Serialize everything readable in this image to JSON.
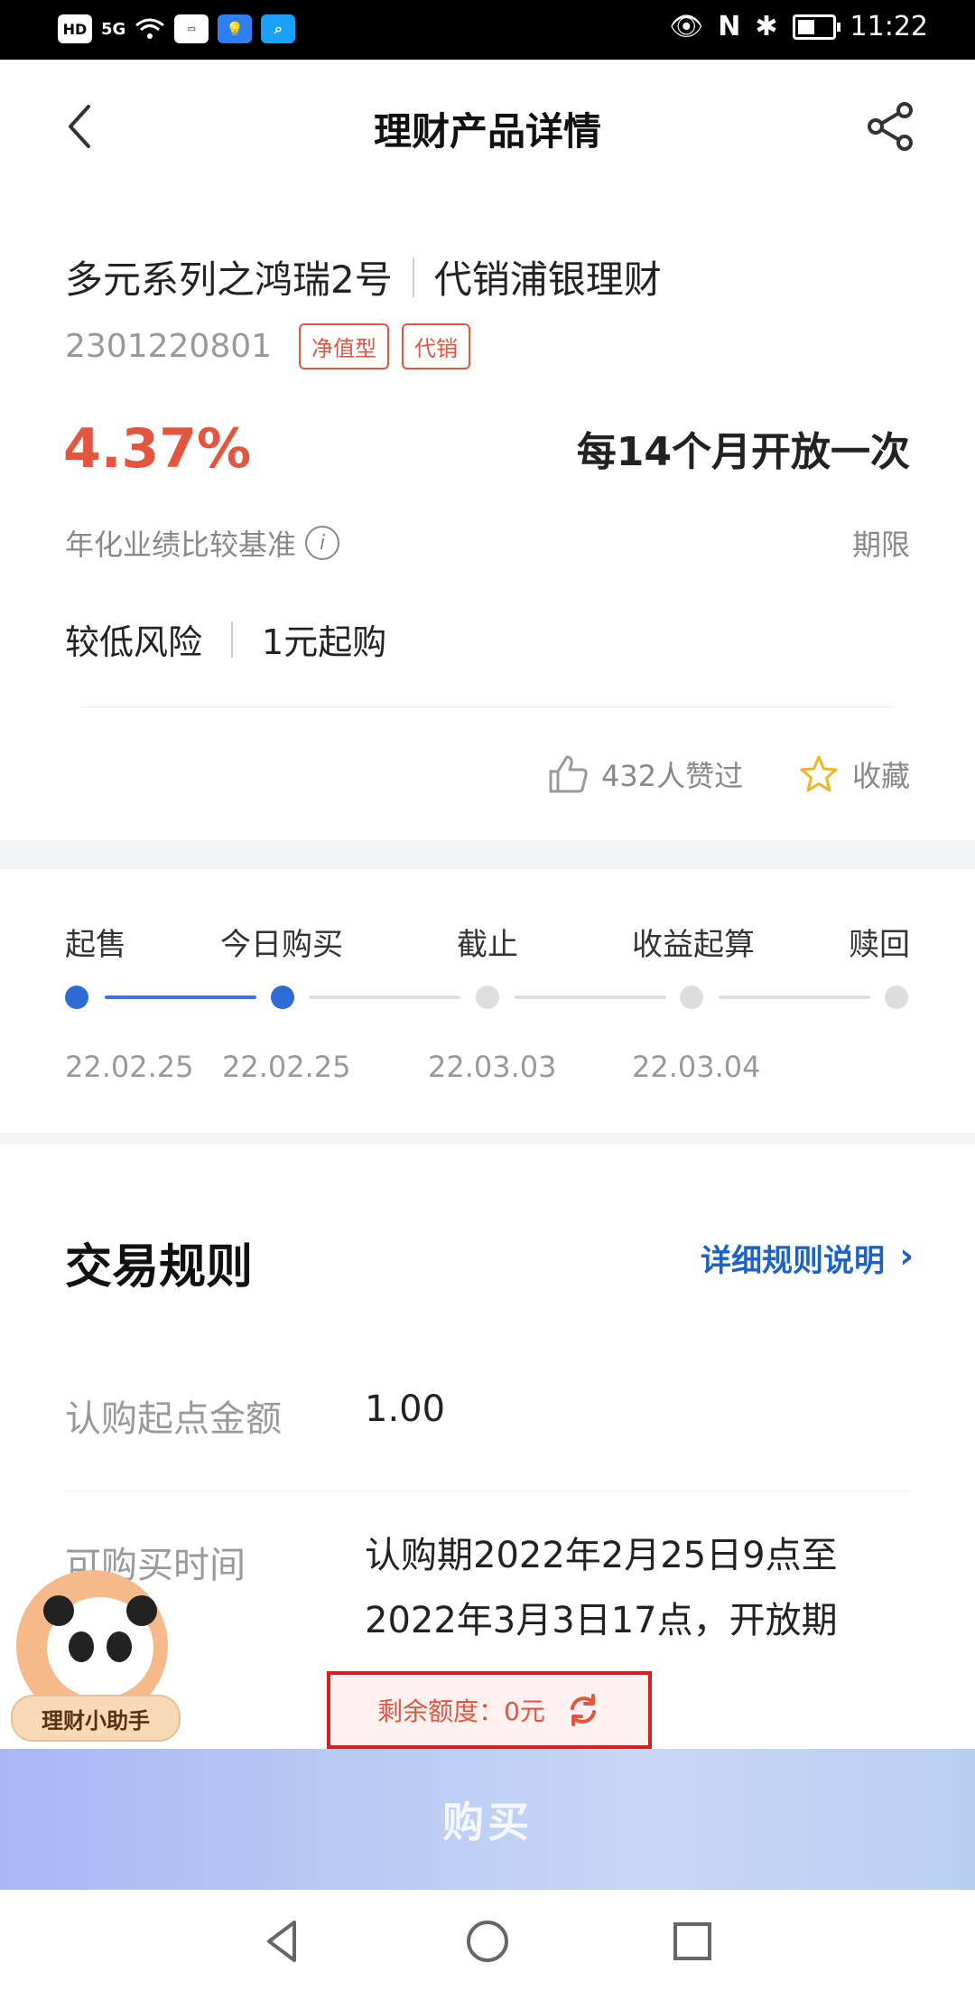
{
  "status_bar": {
    "left_icons": [
      "HD",
      "5G",
      "wifi",
      "app-1",
      "app-2",
      "app-3"
    ],
    "time": "11:22"
  },
  "header": {
    "title": "理财产品详情"
  },
  "product": {
    "name": "多元系列之鸿瑞2号",
    "issuer": "代销浦银理财",
    "code": "2301220801",
    "tags": [
      "净值型",
      "代销"
    ],
    "rate": "4.37%",
    "rate_label": "年化业绩比较基准",
    "period": "每14个月开放一次",
    "period_label": "期限",
    "risk": "较低风险",
    "min_buy": "1元起购",
    "likes": "432人赞过",
    "favorite": "收藏"
  },
  "timeline": {
    "steps": [
      "起售",
      "今日购买",
      "截止",
      "收益起算",
      "赎回"
    ],
    "dates": [
      "22.02.25",
      "22.02.25",
      "22.03.03",
      "22.03.04",
      ""
    ],
    "active_count": 2
  },
  "rules": {
    "title": "交易规则",
    "link": "详细规则说明",
    "rows": [
      {
        "label": "认购起点金额",
        "value": "1.00"
      },
      {
        "label": "可购买时间",
        "value": "认购期2022年2月25日9点至2022年3月3日17点，开放期"
      }
    ]
  },
  "assistant": {
    "label": "理财小助手"
  },
  "remain": {
    "text": "剩余额度：0元"
  },
  "buy": {
    "label": "购买"
  },
  "colors": {
    "accent_red": "#e3553f",
    "brand_blue": "#2e6bd6",
    "link_blue": "#1c63c7"
  }
}
